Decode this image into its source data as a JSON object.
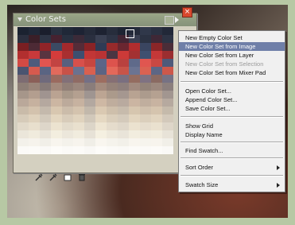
{
  "panel": {
    "title": "Color Sets",
    "close_glyph": "×"
  },
  "icons": {
    "toolbar": [
      "eyedropper-icon",
      "eyedropper-icon",
      "new-swatch-icon",
      "delete-swatch-icon"
    ],
    "panel_menu": "panel-menu-arrow-icon",
    "panel_options": "panel-options-icon"
  },
  "menu": {
    "items": [
      {
        "label": "New Empty Color Set",
        "state": "normal"
      },
      {
        "label": "New Color Set from Image",
        "state": "highlighted"
      },
      {
        "label": "New Color Set from Layer",
        "state": "normal"
      },
      {
        "label": "New Color Set from Selection",
        "state": "disabled"
      },
      {
        "label": "New Color Set from Mixer Pad",
        "state": "normal"
      },
      {
        "label": "Open Color Set...",
        "state": "normal"
      },
      {
        "label": "Append Color Set...",
        "state": "normal"
      },
      {
        "label": "Save Color Set...",
        "state": "normal"
      },
      {
        "label": "Show Grid",
        "state": "normal"
      },
      {
        "label": "Display Name",
        "state": "normal"
      },
      {
        "label": "Find Swatch...",
        "state": "normal"
      },
      {
        "label": "Sort Order",
        "state": "submenu"
      },
      {
        "label": "Swatch Size",
        "state": "submenu"
      }
    ]
  },
  "colors": {
    "highlight": "#6f7fa8",
    "panel_bg": "#d4d0c0",
    "titlebar": "#8e9a80"
  }
}
